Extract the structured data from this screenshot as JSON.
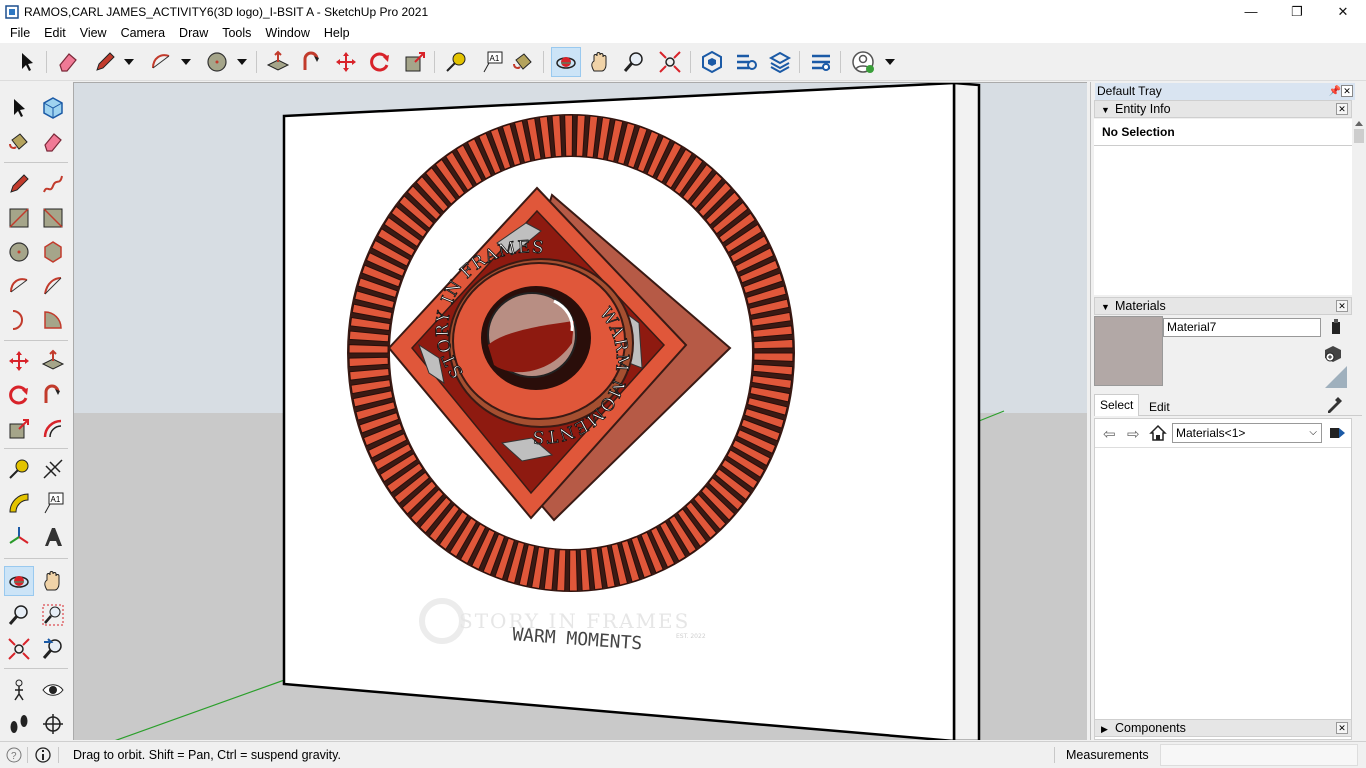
{
  "window": {
    "title": "RAMOS,CARL JAMES_ACTIVITY6(3D logo)_I-BSIT A - SketchUp Pro 2021",
    "minimize_glyph": "—",
    "maximize_glyph": "❐",
    "close_glyph": "✕"
  },
  "menu": [
    "File",
    "Edit",
    "View",
    "Camera",
    "Draw",
    "Tools",
    "Window",
    "Help"
  ],
  "toolbar": {
    "icons": [
      "select-icon",
      "eraser-icon",
      "pencil-icon",
      "arc-icon",
      "circle-icon",
      "push-pull-icon",
      "follow-me-icon",
      "move-icon",
      "rotate-icon",
      "scale-icon",
      "tape-measure-icon",
      "text-icon",
      "paint-bucket-icon",
      "orbit-icon",
      "pan-icon",
      "zoom-icon",
      "zoom-extents-icon",
      "warehouse-icon",
      "extension-warehouse-icon",
      "layout-icon",
      "extension-manager-icon",
      "account-icon"
    ]
  },
  "tray": {
    "title": "Default Tray",
    "entity_info": {
      "header": "Entity Info",
      "selection": "No Selection"
    },
    "materials": {
      "header": "Materials",
      "material_name": "Material7",
      "swatch_color": "#b2a8a6",
      "tabs": [
        "Select",
        "Edit"
      ],
      "collection": "Materials<1>"
    },
    "components": {
      "header": "Components"
    }
  },
  "scene": {
    "watermark_top": "STORY IN FRAMES",
    "watermark_sub": "EST. 2022",
    "watermark_bottom": "WARM MOMENTS",
    "logo_arc_top": "STORY IN FRAMES",
    "logo_arc_bottom": "WARM MOMENTS",
    "colors": {
      "ring": "#e0573a",
      "diamond": "#e0573a",
      "diamond_back": "#b65a46",
      "dark": "#8e1a10",
      "sky": "#d7dde3",
      "ground": "#c9c9c9",
      "canvas": "#ffffff"
    }
  },
  "status": {
    "hint": "Drag to orbit. Shift = Pan, Ctrl = suspend gravity.",
    "measurements_label": "Measurements"
  }
}
